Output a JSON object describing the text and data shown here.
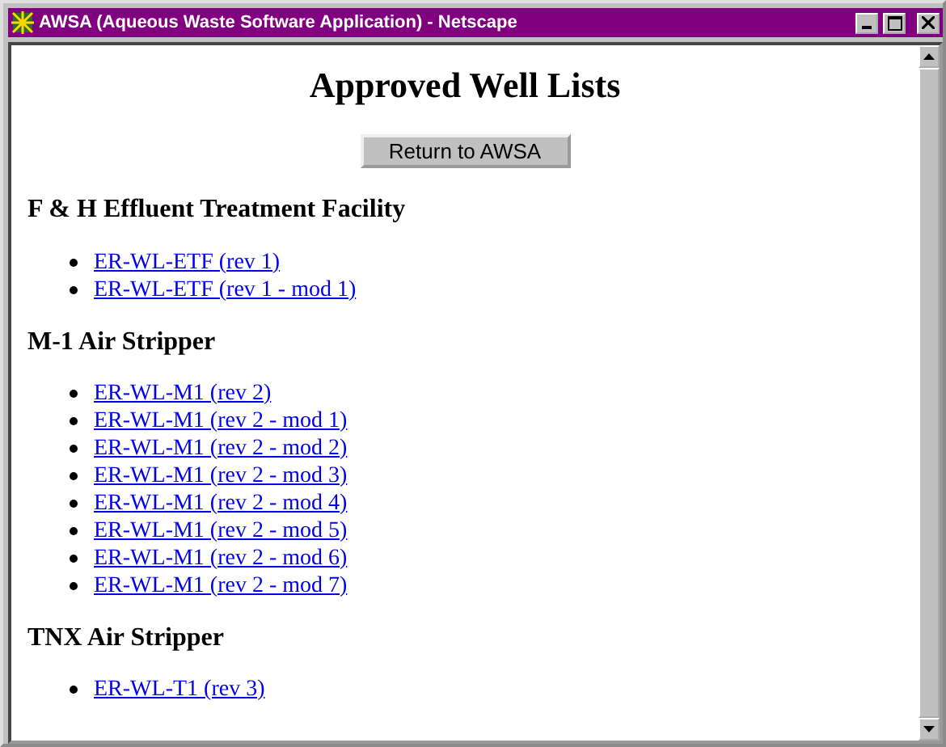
{
  "window": {
    "title": "AWSA (Aqueous Waste Software Application) - Netscape"
  },
  "page": {
    "heading": "Approved Well Lists",
    "button": "Return to AWSA",
    "sections": [
      {
        "title": "F & H Effluent Treatment Facility",
        "links": [
          "ER-WL-ETF (rev 1)",
          "ER-WL-ETF (rev 1 - mod 1)"
        ]
      },
      {
        "title": "M-1 Air Stripper",
        "links": [
          "ER-WL-M1 (rev 2)",
          "ER-WL-M1 (rev 2 - mod 1)",
          "ER-WL-M1 (rev 2 - mod 2)",
          "ER-WL-M1 (rev 2 - mod 3)",
          "ER-WL-M1 (rev 2 - mod 4)",
          "ER-WL-M1 (rev 2 - mod 5)",
          "ER-WL-M1 (rev 2 - mod 6)",
          "ER-WL-M1 (rev 2 - mod 7)"
        ]
      },
      {
        "title": "TNX Air Stripper",
        "links": [
          "ER-WL-T1 (rev 3)"
        ]
      }
    ]
  }
}
